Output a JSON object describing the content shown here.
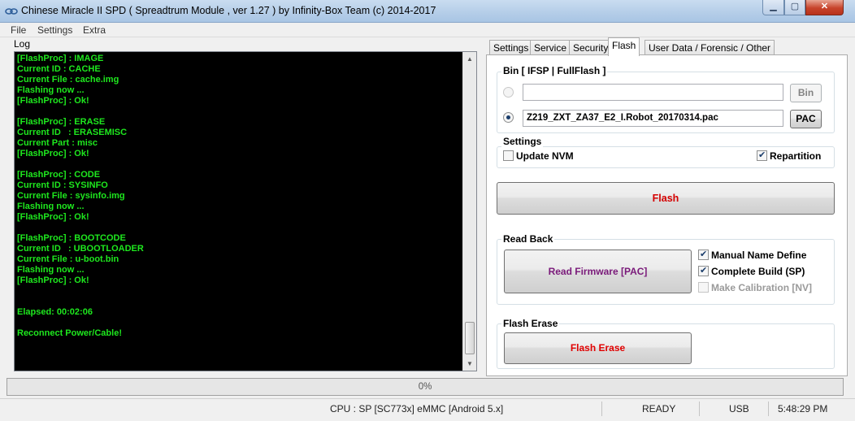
{
  "window": {
    "title": "Chinese Miracle II SPD ( Spreadtrum Module , ver 1.27 ) by Infinity-Box Team (c) 2014-2017",
    "minimize": "▁",
    "maximize": "▢",
    "close": "✕"
  },
  "menu": [
    "File",
    "Settings",
    "Extra"
  ],
  "log": {
    "label": "Log",
    "text": "[FlashProc] : IMAGE\nCurrent ID : CACHE\nCurrent File : cache.img\nFlashing now ...\n[FlashProc] : Ok!\n\n[FlashProc] : ERASE\nCurrent ID   : ERASEMISC\nCurrent Part : misc\n[FlashProc] : Ok!\n\n[FlashProc] : CODE\nCurrent ID : SYSINFO\nCurrent File : sysinfo.img\nFlashing now ...\n[FlashProc] : Ok!\n\n[FlashProc] : BOOTCODE\nCurrent ID   : UBOOTLOADER\nCurrent File : u-boot.bin\nFlashing now ...\n[FlashProc] : Ok!\n\n\nElapsed: 00:02:06\n\nReconnect Power/Cable!"
  },
  "tabs": [
    "Settings",
    "Service",
    "Security",
    "Flash",
    "User Data / Forensic / Other"
  ],
  "active_tab": "Flash",
  "bin_group": {
    "title": "Bin  [ IFSP | FullFlash ]",
    "bin_path": "",
    "bin_button": "Bin",
    "pac_path": "Z219_ZXT_ZA37_E2_I.Robot_20170314.pac",
    "pac_button": "PAC",
    "selected": "pac"
  },
  "settings_group": {
    "title": "Settings",
    "update_nvm": {
      "label": "Update NVM",
      "checked": false
    },
    "repartition": {
      "label": "Repartition",
      "checked": true
    }
  },
  "flash_button": {
    "label": "Flash",
    "color": "#d40000"
  },
  "readback_group": {
    "title": "Read Back",
    "read_firmware": {
      "label": "Read Firmware [PAC]",
      "color": "#7a1a7a"
    },
    "manual_name": {
      "label": "Manual Name Define",
      "checked": true
    },
    "complete_build": {
      "label": "Complete Build (SP)",
      "checked": true
    },
    "make_calibration": {
      "label": "Make Calibration [NV]",
      "checked": false,
      "disabled": true
    }
  },
  "flash_erase_group": {
    "title": "Flash Erase",
    "button": {
      "label": "Flash Erase",
      "color": "#e00000"
    }
  },
  "progress": {
    "label": "0%",
    "value": 0
  },
  "status": {
    "cpu": "CPU : SP [SC773x] eMMC [Android 5.x]",
    "state": "READY",
    "port": "USB",
    "time": "5:48:29 PM"
  },
  "colors": {
    "log_text": "#1ee81e",
    "log_bg": "#000000"
  }
}
